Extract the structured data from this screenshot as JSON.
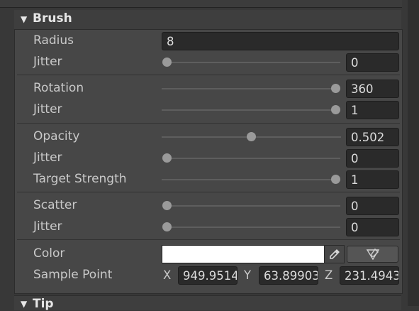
{
  "brush": {
    "title": "Brush",
    "radius": {
      "label": "Radius",
      "value": "8"
    },
    "radius_jitter": {
      "label": "Jitter",
      "value": "0",
      "slider_fraction": 0
    },
    "rotation": {
      "label": "Rotation",
      "value": "360",
      "slider_fraction": 1
    },
    "rotation_jitter": {
      "label": "Jitter",
      "value": "1",
      "slider_fraction": 1
    },
    "opacity": {
      "label": "Opacity",
      "value": "0.502",
      "slider_fraction": 0.502
    },
    "opacity_jitter": {
      "label": "Jitter",
      "value": "0",
      "slider_fraction": 0
    },
    "target_strength": {
      "label": "Target Strength",
      "value": "1",
      "slider_fraction": 1
    },
    "scatter": {
      "label": "Scatter",
      "value": "0",
      "slider_fraction": 0
    },
    "scatter_jitter": {
      "label": "Jitter",
      "value": "0",
      "slider_fraction": 0
    },
    "color": {
      "label": "Color",
      "value": "#ffffff"
    },
    "sample_point": {
      "label": "Sample Point",
      "x_label": "X",
      "x_value": "949.9514",
      "y_label": "Y",
      "y_value": "63.89903",
      "z_label": "Z",
      "z_value": "231.4943"
    }
  },
  "tip": {
    "title": "Tip"
  },
  "icons": [
    "foldout-expanded-icon",
    "eyedropper-icon",
    "eyedropper-pick-icon"
  ]
}
